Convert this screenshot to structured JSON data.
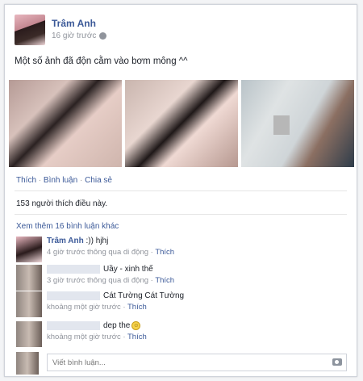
{
  "post": {
    "author": "Trâm Anh",
    "time": "16 giờ trước",
    "privacy_icon": "globe-icon",
    "status": "Một số ảnh đã độn cằm vào bơm mông ^^",
    "photo_count": 3
  },
  "actions": {
    "like": "Thích",
    "comment": "Bình luận",
    "share": "Chia sẻ",
    "sep": " · "
  },
  "likes": "153 người thích điều này.",
  "more_comments": "Xem thêm 16 bình luận khác",
  "comments": [
    {
      "name": "Trâm Anh",
      "text": ":)) hjhj",
      "meta": "4 giờ trước thông qua di động",
      "like": "Thích"
    },
    {
      "name": "",
      "text": "Uầy - xinh thế",
      "meta": "3 giờ trước thông qua di động",
      "like": "Thích"
    },
    {
      "name": "",
      "text": "Cát Tường Cát Tường",
      "meta": "khoảng một giờ trước",
      "like": "Thích"
    },
    {
      "name": "",
      "text": "dep the",
      "meta": "khoảng một giờ trước",
      "like": "Thích"
    }
  ],
  "comment_input": {
    "placeholder": "Viết bình luận...",
    "icon": "camera-icon"
  },
  "colors": {
    "link": "#3b5998",
    "meta": "#90949c",
    "border": "#cfd3da"
  }
}
